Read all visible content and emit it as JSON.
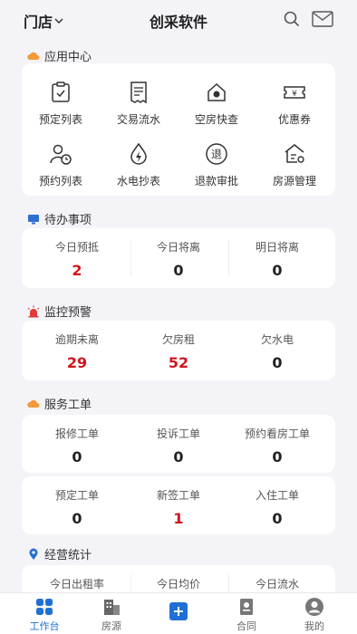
{
  "header": {
    "store_label": "门店",
    "title": "创采软件"
  },
  "sections": {
    "app_center": "应用中心",
    "todo": "待办事项",
    "monitor": "监控预警",
    "service": "服务工单",
    "stats": "经营统计"
  },
  "apps": [
    {
      "label": "预定列表",
      "icon": "clipboard-icon"
    },
    {
      "label": "交易流水",
      "icon": "receipt-icon"
    },
    {
      "label": "空房快查",
      "icon": "room-icon"
    },
    {
      "label": "优惠券",
      "icon": "coupon-icon"
    },
    {
      "label": "预约列表",
      "icon": "user-clock-icon"
    },
    {
      "label": "水电抄表",
      "icon": "water-electric-icon"
    },
    {
      "label": "退款审批",
      "icon": "refund-icon"
    },
    {
      "label": "房源管理",
      "icon": "house-settings-icon"
    }
  ],
  "todo": [
    {
      "label": "今日预抵",
      "value": "2",
      "highlight": true
    },
    {
      "label": "今日将离",
      "value": "0",
      "highlight": false
    },
    {
      "label": "明日将离",
      "value": "0",
      "highlight": false
    }
  ],
  "monitor": [
    {
      "label": "逾期未离",
      "value": "29",
      "highlight": true
    },
    {
      "label": "欠房租",
      "value": "52",
      "highlight": true
    },
    {
      "label": "欠水电",
      "value": "0",
      "highlight": false
    }
  ],
  "service_row1": [
    {
      "label": "报修工单",
      "value": "0",
      "highlight": false
    },
    {
      "label": "投诉工单",
      "value": "0",
      "highlight": false
    },
    {
      "label": "预约看房工单",
      "value": "0",
      "highlight": false
    }
  ],
  "service_row2": [
    {
      "label": "预定工单",
      "value": "0",
      "highlight": false
    },
    {
      "label": "新签工单",
      "value": "1",
      "highlight": true
    },
    {
      "label": "入住工单",
      "value": "0",
      "highlight": false
    }
  ],
  "stats": [
    {
      "label": "今日出租率"
    },
    {
      "label": "今日均价"
    },
    {
      "label": "今日流水"
    }
  ],
  "tabs": [
    {
      "label": "工作台",
      "icon": "dashboard-icon",
      "active": true
    },
    {
      "label": "房源",
      "icon": "building-icon",
      "active": false
    },
    {
      "label": "",
      "icon": "add-icon",
      "active": false
    },
    {
      "label": "合同",
      "icon": "contract-icon",
      "active": false
    },
    {
      "label": "我的",
      "icon": "profile-icon",
      "active": false
    }
  ],
  "colors": {
    "accent": "#1f6fd6",
    "highlight": "#d0151c",
    "section_icon": "#f39a3b"
  }
}
